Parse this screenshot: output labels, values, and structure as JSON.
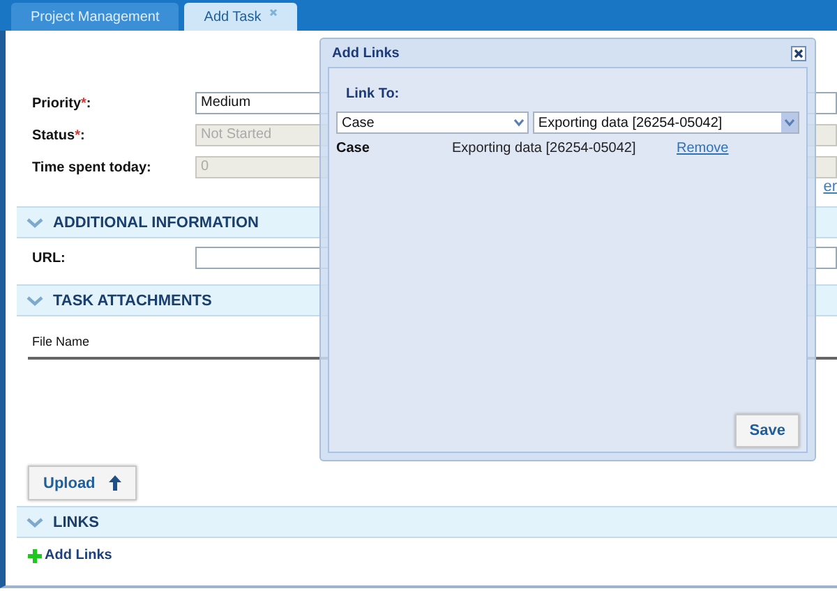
{
  "tabs": [
    {
      "label": "Project Management",
      "selected": false,
      "closable": false
    },
    {
      "label": "Add Task",
      "selected": true,
      "closable": true
    }
  ],
  "form": [
    {
      "label": "Priority",
      "required_mark": "*",
      "label_end": ":",
      "value": "Medium",
      "disabled": false
    },
    {
      "label": "Status",
      "required_mark": "*",
      "label_end": ":",
      "value": "Not Started",
      "disabled": true
    },
    {
      "label": "Time spent today:",
      "value": "0",
      "disabled": true
    }
  ],
  "partial_link": "er",
  "sections": [
    {
      "title": "ADDITIONAL INFORMATION",
      "expanded": true,
      "kind": "fields",
      "fields": [
        {
          "label": "URL:"
        }
      ]
    },
    {
      "title": "TASK ATTACHMENTS",
      "expanded": true,
      "kind": "attachments",
      "columns": [
        "File Name"
      ],
      "button": "Upload"
    },
    {
      "title": "LINKS",
      "expanded": true,
      "kind": "links",
      "action": "Add Links"
    }
  ],
  "dialog": {
    "title": "Add Links",
    "link_to_label": "Link To:",
    "type_select": "Case",
    "item_select": "Exporting data  [26254-05042]",
    "links": [
      {
        "type": "Case",
        "item": "Exporting data [26254-05042]",
        "action": "Remove"
      }
    ],
    "button": "Save"
  }
}
